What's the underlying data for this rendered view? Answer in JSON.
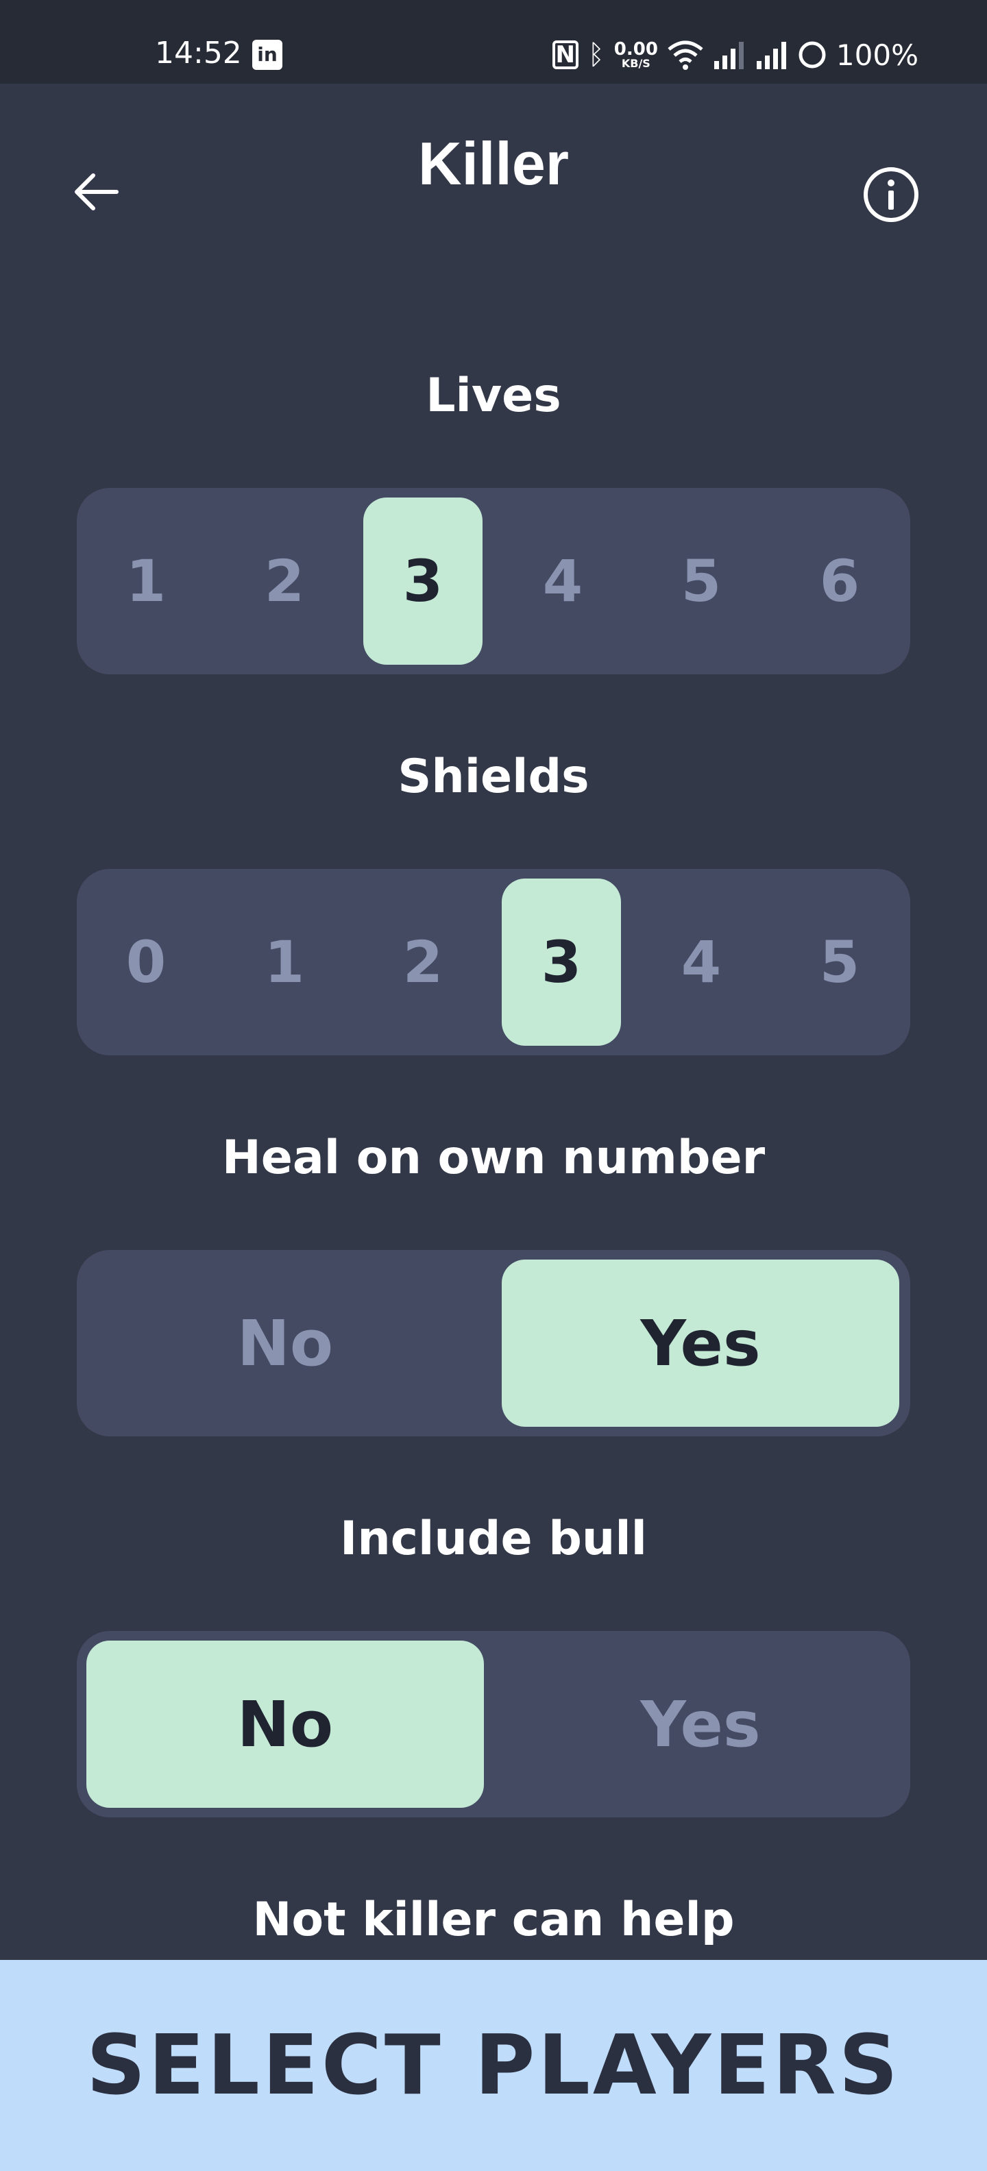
{
  "status_bar": {
    "time": "14:52",
    "app_icon_glyph": "in",
    "nfc_glyph": "N",
    "bluetooth_glyph": "ᛒ",
    "net_speed_value": "0.00",
    "net_speed_unit": "KB/S",
    "battery": "100%"
  },
  "header": {
    "title": "Killer"
  },
  "settings": {
    "lives": {
      "label": "Lives",
      "options": [
        "1",
        "2",
        "3",
        "4",
        "5",
        "6"
      ],
      "selected": "3"
    },
    "shields": {
      "label": "Shields",
      "options": [
        "0",
        "1",
        "2",
        "3",
        "4",
        "5"
      ],
      "selected": "3"
    },
    "heal_on_own_number": {
      "label": "Heal on own number",
      "options": [
        "No",
        "Yes"
      ],
      "selected": "Yes"
    },
    "include_bull": {
      "label": "Include bull",
      "options": [
        "No",
        "Yes"
      ],
      "selected": "No"
    },
    "not_killer_can_help": {
      "label": "Not killer can help"
    }
  },
  "cta": {
    "label": "SELECT PLAYERS"
  },
  "colors": {
    "background": "#333848",
    "status_bar": "#272b35",
    "segment_bg": "#434a62",
    "selected": "#c4ead6",
    "unselected_text": "#8a93b0",
    "cta_bg": "#c0dcfb"
  }
}
